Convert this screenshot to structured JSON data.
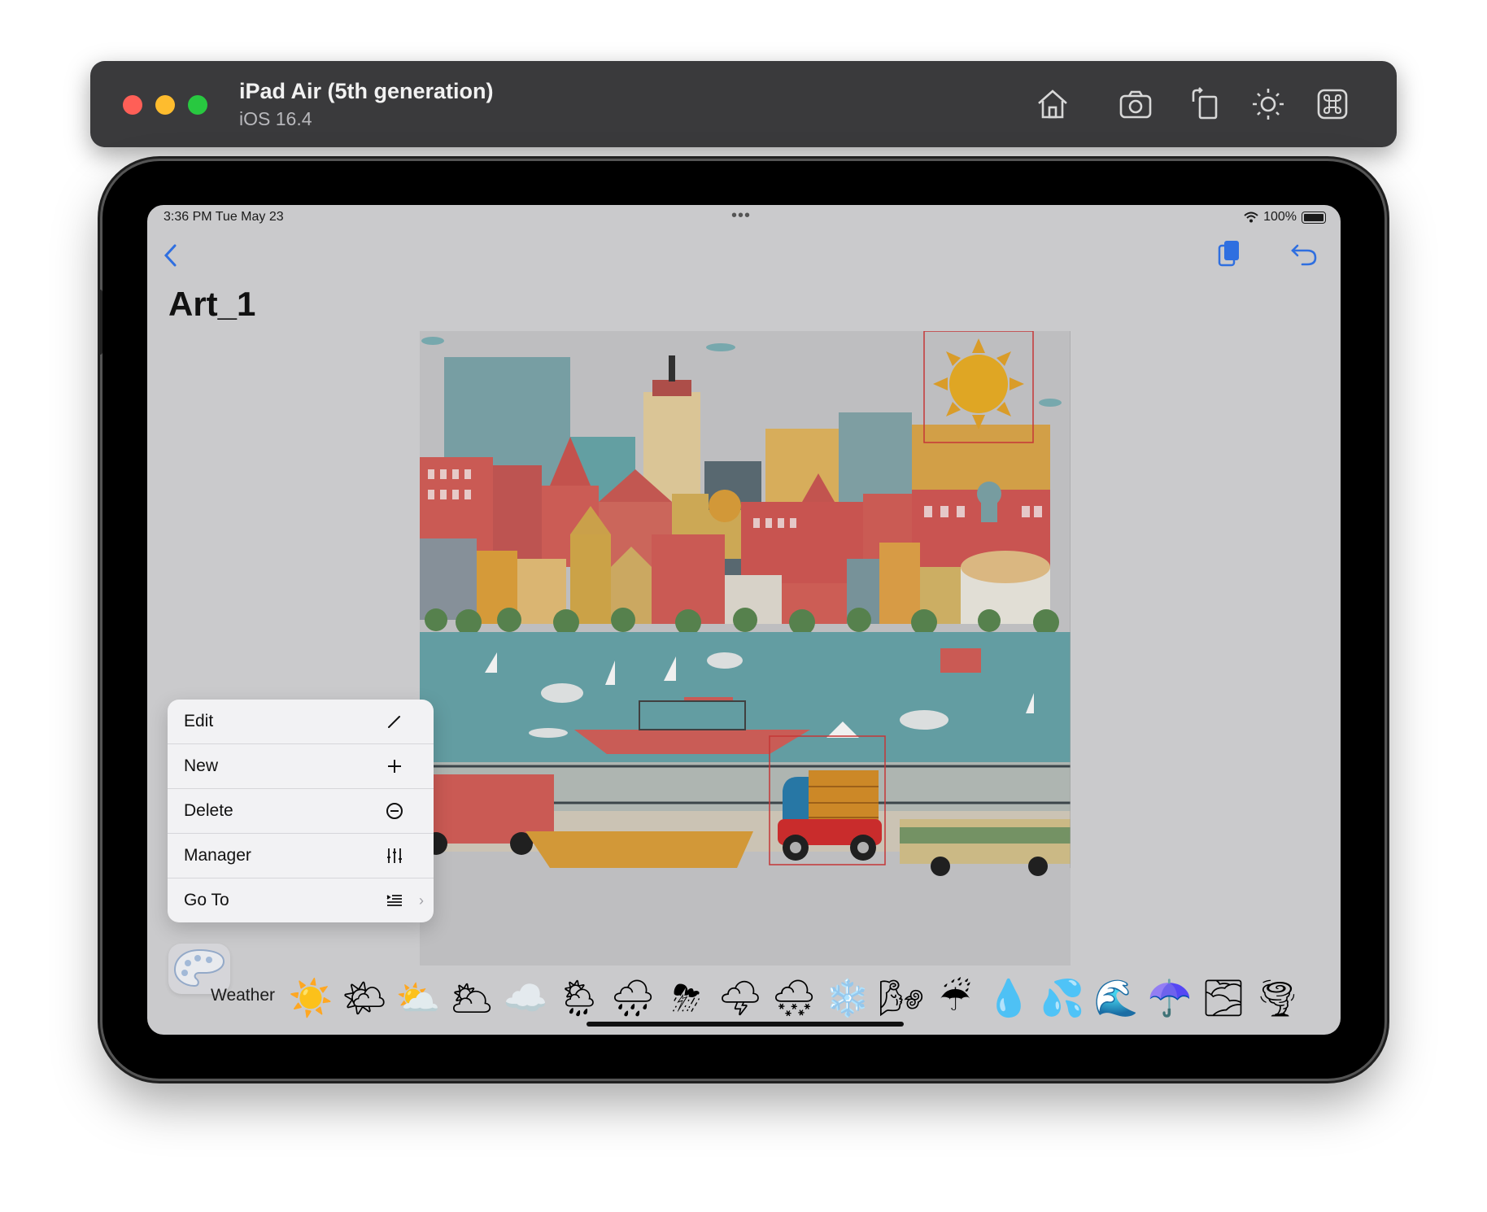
{
  "simulator": {
    "device_name": "iPad Air (5th generation)",
    "os_version": "iOS 16.4",
    "toolbar_icons": [
      "home-icon",
      "screenshot-icon",
      "rotate-icon",
      "appearance-icon",
      "command-icon"
    ]
  },
  "status_bar": {
    "time_date": "3:36 PM   Tue May 23",
    "multitask": "•••",
    "battery": "100%"
  },
  "nav": {
    "back_icon": "chevron-left-icon",
    "copy_icon": "copy-icon",
    "undo_icon": "undo-icon"
  },
  "page": {
    "title": "Art_1"
  },
  "menu": {
    "items": [
      {
        "label": "Edit",
        "icon": "pencil-icon"
      },
      {
        "label": "New",
        "icon": "plus-icon"
      },
      {
        "label": "Delete",
        "icon": "minus-circle-icon"
      },
      {
        "label": "Manager",
        "icon": "sliders-icon"
      },
      {
        "label": "Go To",
        "icon": "list-indent-icon",
        "submenu": "›"
      }
    ]
  },
  "palette": {
    "icon": "palette-icon"
  },
  "weather_bar": {
    "label": "Weather",
    "emojis": [
      "☀️",
      "🌤",
      "⛅",
      "🌥",
      "☁️",
      "🌦",
      "🌧",
      "⛈",
      "🌩",
      "🌨",
      "❄️",
      "🌬",
      "☔",
      "💧",
      "💦",
      "🌊",
      "☂️",
      "🌫",
      "🌪"
    ]
  },
  "colors": {
    "accent": "#2f6fe0",
    "screen_bg": "#cacacc",
    "menu_bg": "#f2f2f4",
    "water": "#6aa7ad",
    "selection": "#d23b3b"
  }
}
